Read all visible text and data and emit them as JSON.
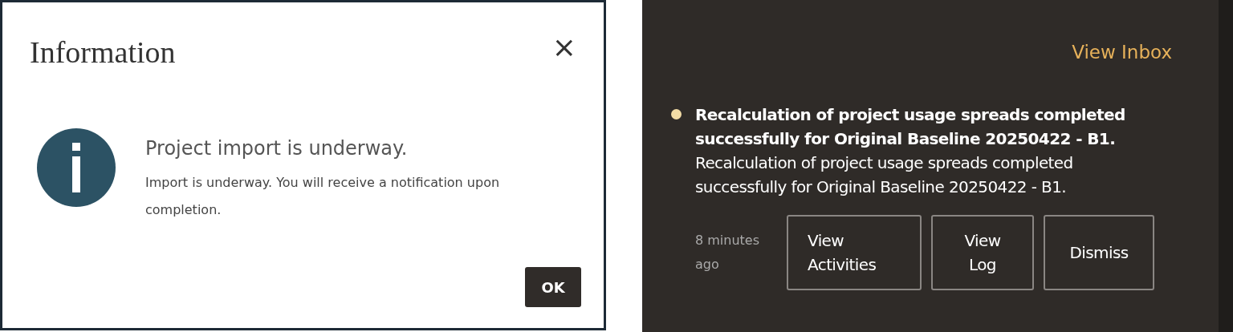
{
  "dialog": {
    "title": "Information",
    "close": "×",
    "heading": "Project import is underway.",
    "message": "Import is underway. You will receive a notification upon completion.",
    "button": "OK"
  },
  "notifications_panel": {
    "link": "View Inbox",
    "items": [
      {
        "unread": true,
        "title": "Recalculation of project usage spreads completed successfully for Original Baseline 20250422 - B1.",
        "body": "Recalculation of project usage spreads completed successfully for Original Baseline 20250422 - B1.",
        "time": "8 minutes ago",
        "actions": [
          "View Activities",
          "View Log",
          "Dismiss"
        ]
      }
    ]
  }
}
